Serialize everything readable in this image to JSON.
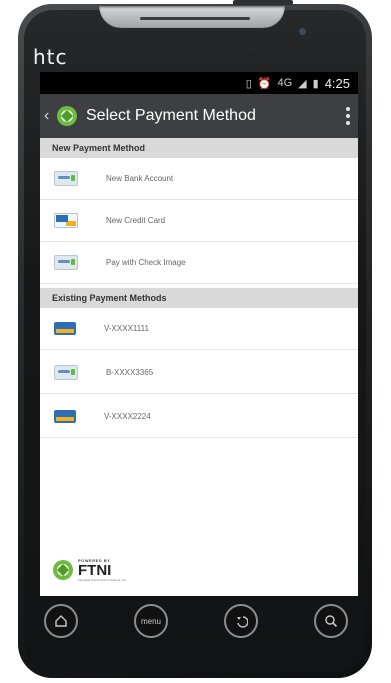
{
  "device": {
    "brand": "htc"
  },
  "status_bar": {
    "icons": [
      "vibrate-icon",
      "alarm-icon",
      "4g-icon",
      "signal-icon",
      "battery-icon"
    ],
    "network": "4G",
    "time": "4:25"
  },
  "action_bar": {
    "title": "Select Payment Method"
  },
  "sections": {
    "new": {
      "header": "New Payment Method",
      "items": [
        {
          "icon": "echeck-icon",
          "label": "New Bank Account"
        },
        {
          "icon": "credit-cards-icon",
          "label": "New Credit Card"
        },
        {
          "icon": "echeck-icon",
          "label": "Pay with Check Image"
        }
      ]
    },
    "existing": {
      "header": "Existing Payment Methods",
      "items": [
        {
          "icon": "visa-card-icon",
          "label": "V-XXXX1111"
        },
        {
          "icon": "echeck-icon",
          "label": "B-XXXX3365"
        },
        {
          "icon": "visa-card-icon",
          "label": "V-XXXX2224"
        }
      ]
    }
  },
  "footer": {
    "powered_by": "POWERED BY",
    "brand": "FTNI",
    "tagline": "Financial Transmission Network, Inc."
  },
  "nav_buttons": {
    "home": "home-icon",
    "menu": "menu",
    "back": "back-icon",
    "search": "search-icon"
  },
  "colors": {
    "action_bar": "#3d3f42",
    "section_header": "#d9d9d9",
    "logo_green": "#6dbb3f",
    "card_blue": "#2d6fb5"
  }
}
